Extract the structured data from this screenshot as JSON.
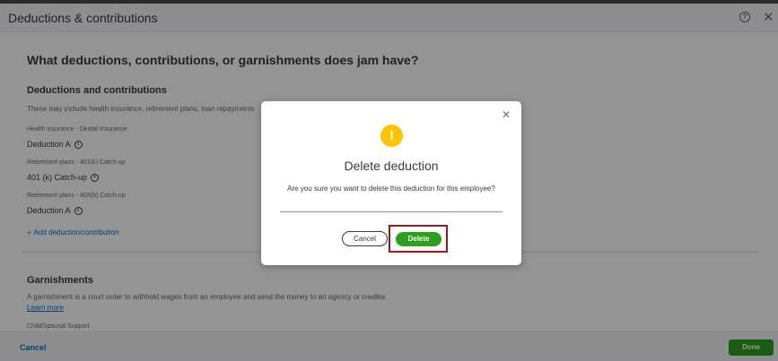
{
  "header": {
    "title": "Deductions & contributions",
    "help_icon": "help-circle-icon",
    "help_glyph": "?",
    "close_icon": "close-icon",
    "close_glyph": "✕"
  },
  "main": {
    "question": "What deductions, contributions, or garnishments does jam have?",
    "deductions_section": {
      "title": "Deductions and contributions",
      "description": "These may include health insurance, retirement plans, loan repayments",
      "items": [
        {
          "category": "Health insurance - Dental Insurance",
          "name": "Deduction A"
        },
        {
          "category": "Retirement plans - 401(k) Catch-up",
          "name": "401 (k) Catch-up"
        },
        {
          "category": "Retirement plans - 403(b) Catch-up",
          "name": "Deduction A"
        }
      ],
      "info_glyph": "i",
      "add_plus": "+",
      "add_label": "Add deduction/contribution"
    },
    "garnishments_section": {
      "title": "Garnishments",
      "description": "A garnishment is a court order to withhold wages from an employee and send the money to an agency or creditor.",
      "learn_more": "Learn more",
      "first_item": "Child/Spousal Support"
    }
  },
  "footer": {
    "cancel_label": "Cancel",
    "done_label": "Done"
  },
  "dialog": {
    "icon": "warning-icon",
    "icon_glyph": "!",
    "close_glyph": "✕",
    "title": "Delete deduction",
    "message": "Are you sure you want to delete this deduction for this employee?",
    "cancel_label": "Cancel",
    "delete_label": "Delete"
  },
  "colors": {
    "primary_green": "#2ca01c",
    "link_blue": "#0077c5",
    "warning_yellow": "#ffc400",
    "highlight_red": "#a41618"
  }
}
